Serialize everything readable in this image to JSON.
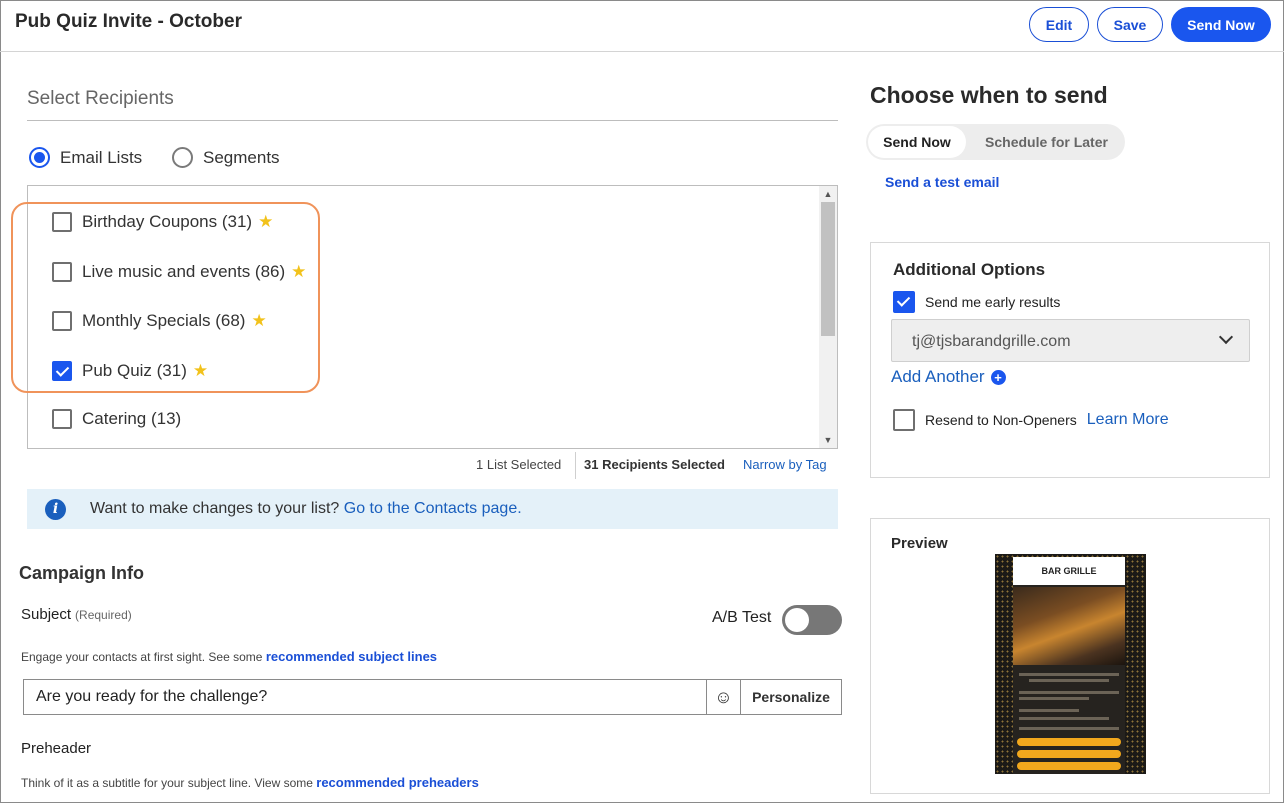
{
  "header": {
    "title": "Pub Quiz Invite - October",
    "buttons": {
      "edit": "Edit",
      "save": "Save",
      "send_now": "Send Now"
    }
  },
  "recipients": {
    "title": "Select Recipients",
    "radio": {
      "email_lists": "Email Lists",
      "segments": "Segments",
      "selected": "Email Lists"
    },
    "lists": [
      {
        "label": "Birthday Coupons (31)",
        "checked": false,
        "starred": true
      },
      {
        "label": "Live music and events (86)",
        "checked": false,
        "starred": true
      },
      {
        "label": "Monthly Specials (68)",
        "checked": false,
        "starred": true
      },
      {
        "label": "Pub Quiz (31)",
        "checked": true,
        "starred": true
      },
      {
        "label": "Catering (13)",
        "checked": false,
        "starred": false
      }
    ],
    "status": {
      "lists_selected": "1 List Selected",
      "recipients_selected": "31 Recipients Selected",
      "narrow": "Narrow by Tag"
    },
    "info": {
      "text": "Want to make changes to your list?",
      "link": "Go to the Contacts page."
    },
    "highlight_color": "#f0935a",
    "star_color": "#f2c21b"
  },
  "campaign": {
    "title": "Campaign Info",
    "subject_label": "Subject",
    "subject_required": "(Required)",
    "ab_test_label": "A/B Test",
    "ab_test_on": false,
    "subject_hint": "Engage your contacts at first sight. See some",
    "subject_hint_link": "recommended subject lines",
    "subject_value": "Are you ready for the challenge?",
    "emoji_icon": "smiley-icon",
    "personalize": "Personalize",
    "preheader_label": "Preheader",
    "preheader_hint": "Think of it as a subtitle for your subject line. View some",
    "preheader_hint_link": "recommended preheaders"
  },
  "schedule": {
    "title": "Choose when to send",
    "options": [
      "Send Now",
      "Schedule for Later"
    ],
    "selected": "Send Now",
    "test_link": "Send a test email"
  },
  "options": {
    "title": "Additional Options",
    "early_results_label": "Send me early results",
    "early_results_checked": true,
    "email_value": "tj@tjsbarandgrille.com",
    "add_another": "Add Another",
    "resend_label": "Resend to Non-Openers",
    "resend_checked": false,
    "learn_more": "Learn More"
  },
  "preview": {
    "title": "Preview",
    "logo_text": "BAR GRILLE"
  },
  "colors": {
    "primary": "#1a56ee",
    "link": "#1a5fbd",
    "info_bg": "#e4f1f9"
  }
}
